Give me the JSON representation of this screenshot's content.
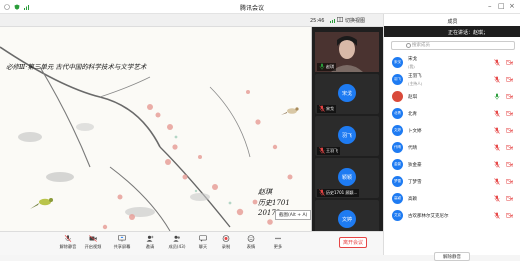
{
  "window": {
    "title": "腾讯会议"
  },
  "sharebar": {
    "clock": "25:46",
    "layout_label": "切换视图"
  },
  "slide": {
    "title": "必修Ⅲ·第三单元 古代中国的科学技术与文学艺术",
    "signature_name": "赵琪",
    "signature_class": "历史1701",
    "signature_id": "20172"
  },
  "screen_tip": "截图(Alt + A)",
  "thumbnails": [
    {
      "label": "赵琪",
      "type": "camera",
      "mic": "on"
    },
    {
      "label": "宋戈",
      "type": "avatar",
      "avatar": "宋戈",
      "mic": "muted"
    },
    {
      "label": "王羽飞",
      "type": "avatar",
      "avatar": "羽飞",
      "mic": "muted"
    },
    {
      "label": "历史1701 顾颖...",
      "type": "avatar",
      "avatar": "颖颖",
      "mic": "muted"
    },
    {
      "label": "历史1701 文婷...",
      "type": "avatar",
      "avatar": "文婷",
      "mic": "muted"
    }
  ],
  "toolbar": {
    "items": [
      {
        "label": "解除静音",
        "icon": "mic-muted-icon"
      },
      {
        "label": "开启视频",
        "icon": "camera-off-icon"
      },
      {
        "label": "共享屏幕",
        "icon": "share-screen-icon"
      },
      {
        "label": "邀请",
        "icon": "invite-icon"
      },
      {
        "label": "成员(43)",
        "icon": "members-icon"
      },
      {
        "label": "聊天",
        "icon": "chat-icon"
      },
      {
        "label": "录制",
        "icon": "record-icon"
      },
      {
        "label": "表情",
        "icon": "emoji-icon"
      },
      {
        "label": "更多",
        "icon": "more-icon"
      }
    ],
    "end_label": "离开会议"
  },
  "panel": {
    "title": "成员",
    "speaking": "正在讲话：赵琪；",
    "search_placeholder": "搜索成员",
    "members": [
      {
        "name": "宋戈",
        "sub": "(我)",
        "avatar": "宋戈",
        "color": "#1e7bf2"
      },
      {
        "name": "王羽飞",
        "sub": "(主持人)",
        "avatar": "羽飞",
        "color": "#1e7bf2"
      },
      {
        "name": "赵琪",
        "sub": "",
        "avatar": "",
        "color": "#d94a3a"
      },
      {
        "name": "北青",
        "sub": "",
        "avatar": "北青",
        "color": "#1e7bf2"
      },
      {
        "name": "卜文婷",
        "sub": "",
        "avatar": "文婷",
        "color": "#1e7bf2"
      },
      {
        "name": "代晴",
        "sub": "",
        "avatar": "代晴",
        "color": "#1e7bf2"
      },
      {
        "name": "狄金豪",
        "sub": "",
        "avatar": "金豪",
        "color": "#1e7bf2"
      },
      {
        "name": "丁梦雪",
        "sub": "",
        "avatar": "梦雪",
        "color": "#1e7bf2"
      },
      {
        "name": "高颖",
        "sub": "",
        "avatar": "高颖",
        "color": "#1e7bf2"
      },
      {
        "name": "古欢那林尔艾克尼尔",
        "sub": "",
        "avatar": "艾克",
        "color": "#1e7bf2"
      }
    ],
    "mute_all_label": "解除静音"
  }
}
